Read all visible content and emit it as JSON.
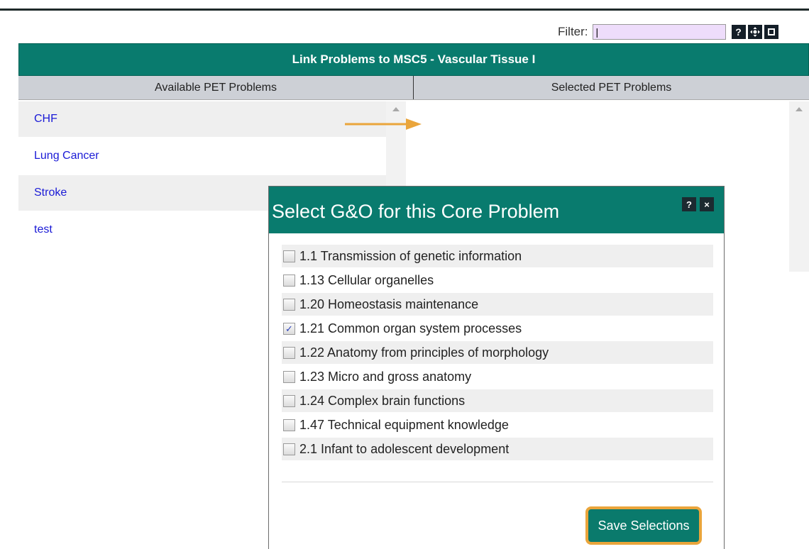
{
  "filter": {
    "label": "Filter:",
    "value": "|",
    "buttons": [
      "?",
      "move",
      "restore"
    ]
  },
  "panel": {
    "title": "Link Problems to MSC5 - Vascular Tissue I",
    "col_left": "Available PET Problems",
    "col_right": "Selected PET Problems",
    "available": [
      "CHF",
      "Lung Cancer",
      "Stroke",
      "test"
    ],
    "selected": []
  },
  "dialog": {
    "title": "Select G&O for this Core Problem",
    "help_label": "?",
    "close_label": "×",
    "items": [
      {
        "label": "1.1 Transmission of genetic information",
        "checked": false
      },
      {
        "label": "1.13 Cellular organelles",
        "checked": false
      },
      {
        "label": "1.20 Homeostasis maintenance",
        "checked": false
      },
      {
        "label": "1.21 Common organ system processes",
        "checked": true
      },
      {
        "label": "1.22 Anatomy from principles of morphology",
        "checked": false
      },
      {
        "label": "1.23 Micro and gross anatomy",
        "checked": false
      },
      {
        "label": "1.24 Complex brain functions",
        "checked": false
      },
      {
        "label": "1.47 Technical equipment knowledge",
        "checked": false
      },
      {
        "label": "2.1 Infant to adolescent development",
        "checked": false
      }
    ],
    "save_label": "Save Selections"
  },
  "colors": {
    "teal": "#097b6e",
    "highlight": "#eaa53b",
    "link": "#1a1ad6"
  }
}
